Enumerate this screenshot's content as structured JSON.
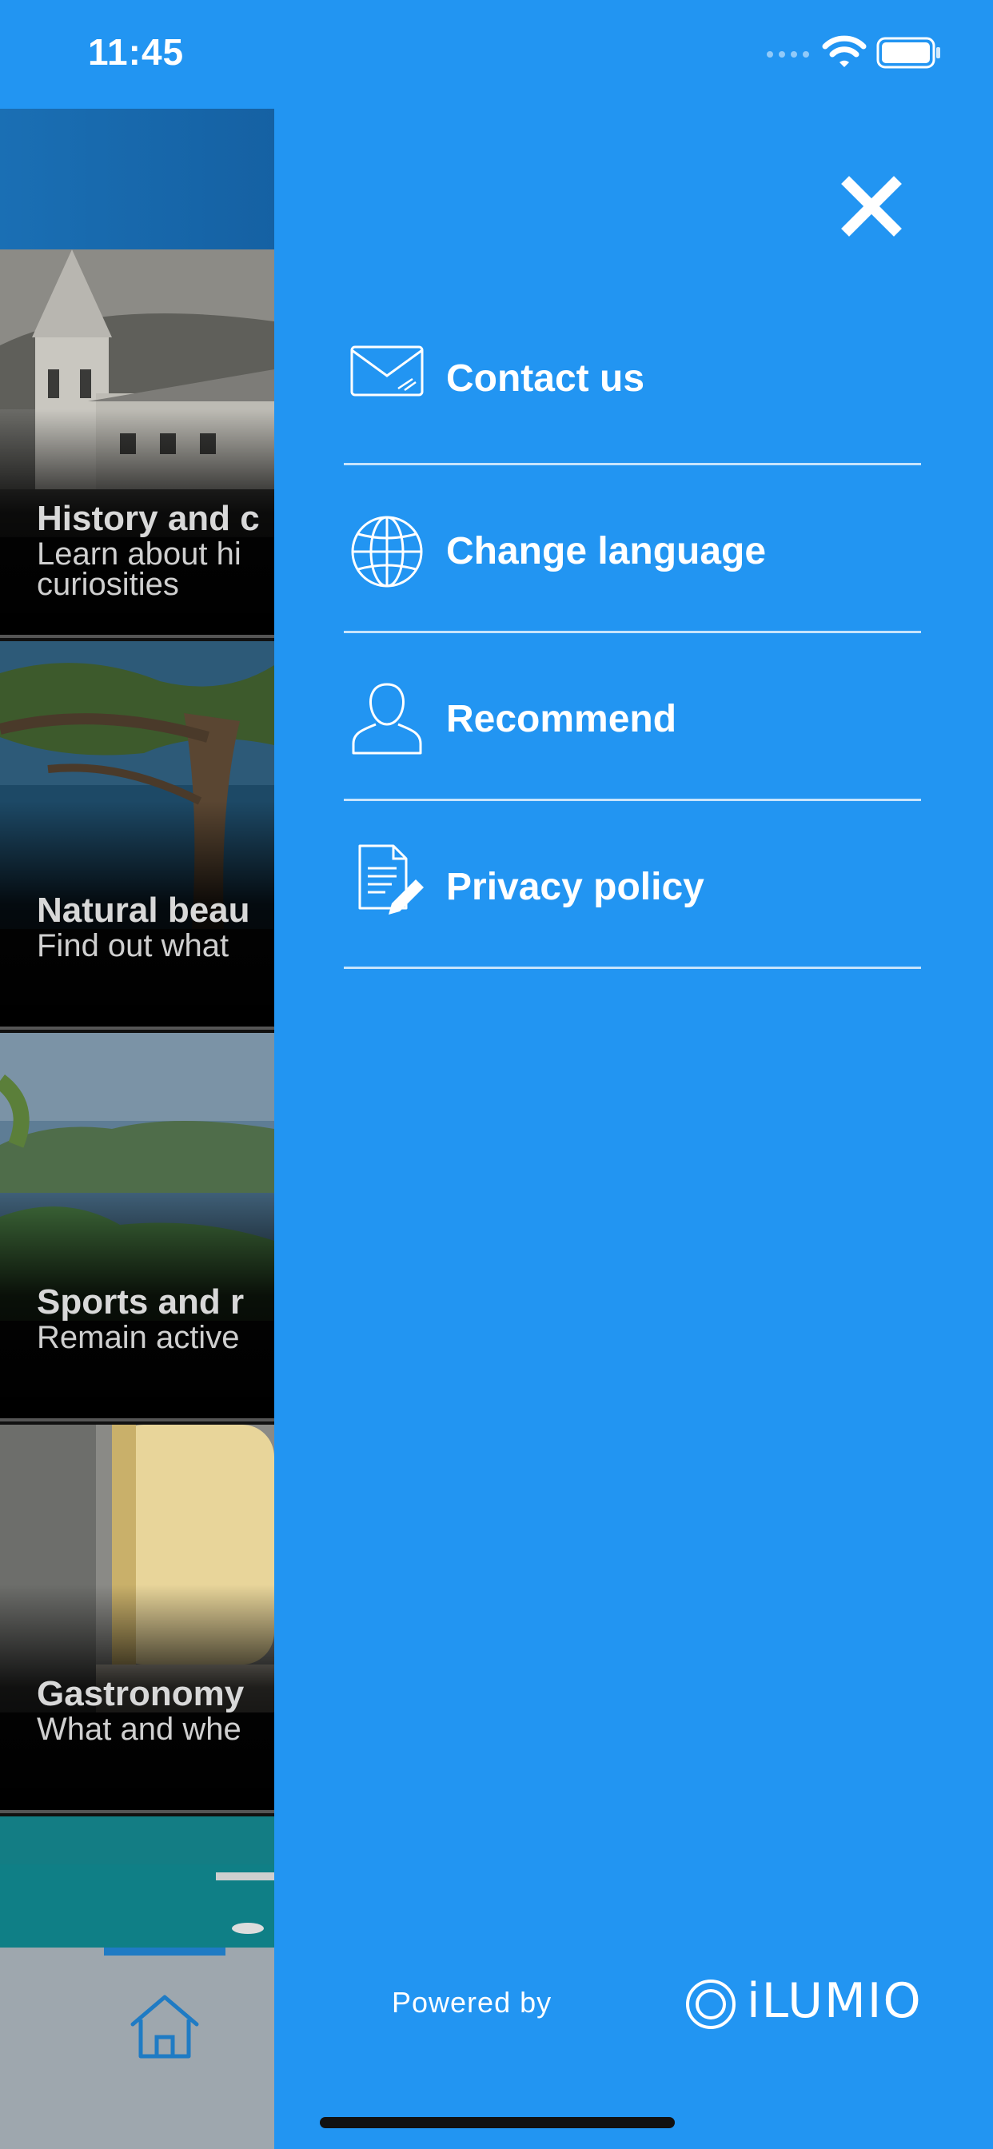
{
  "status_bar": {
    "time": "11:45"
  },
  "background_app": {
    "cards": [
      {
        "title": "History and c",
        "subtitle_line1": "Learn about hi",
        "subtitle_line2": "curiosities"
      },
      {
        "title": "Natural beau",
        "subtitle_line1": "Find out what",
        "subtitle_line2": ""
      },
      {
        "title": "Sports and r",
        "subtitle_line1": "Remain active",
        "subtitle_line2": ""
      },
      {
        "title": "Gastronomy",
        "subtitle_line1": "What and whe",
        "subtitle_line2": ""
      }
    ],
    "tab_icon": "home-icon"
  },
  "menu": {
    "close_icon": "close-icon",
    "items": [
      {
        "label": "Contact us",
        "icon": "envelope-icon"
      },
      {
        "label": "Change language",
        "icon": "globe-icon"
      },
      {
        "label": "Recommend",
        "icon": "person-icon"
      },
      {
        "label": "Privacy policy",
        "icon": "document-edit-icon"
      }
    ],
    "footer": {
      "powered_by": "Powered by",
      "brand": "iLUMIO"
    }
  },
  "colors": {
    "menu_bg": "#2295f2",
    "tab_accent": "#1f7bc4"
  }
}
